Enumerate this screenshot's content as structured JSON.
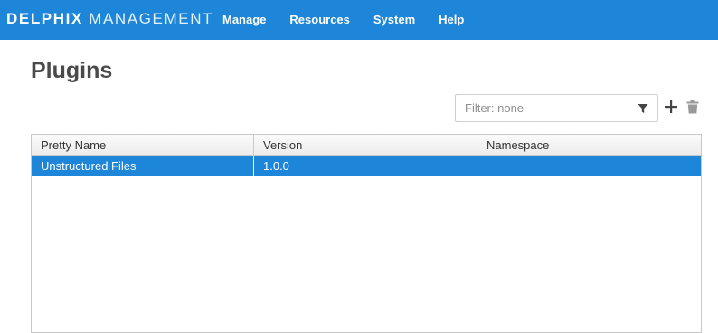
{
  "header": {
    "brand_bold": "DELPHIX",
    "brand_light": "MANAGEMENT",
    "nav": [
      "Manage",
      "Resources",
      "System",
      "Help"
    ],
    "background": "#1d86d8"
  },
  "page": {
    "title": "Plugins"
  },
  "toolbar": {
    "filter_placeholder": "Filter: none",
    "filter_icon": "funnel-icon",
    "add_icon": "plus-icon",
    "delete_icon": "trash-icon"
  },
  "table": {
    "columns": [
      "Pretty Name",
      "Version",
      "Namespace"
    ],
    "rows": [
      {
        "pretty_name": "Unstructured Files",
        "version": "1.0.0",
        "namespace": "",
        "selected": true
      }
    ],
    "selection_color": "#1d86d8"
  }
}
